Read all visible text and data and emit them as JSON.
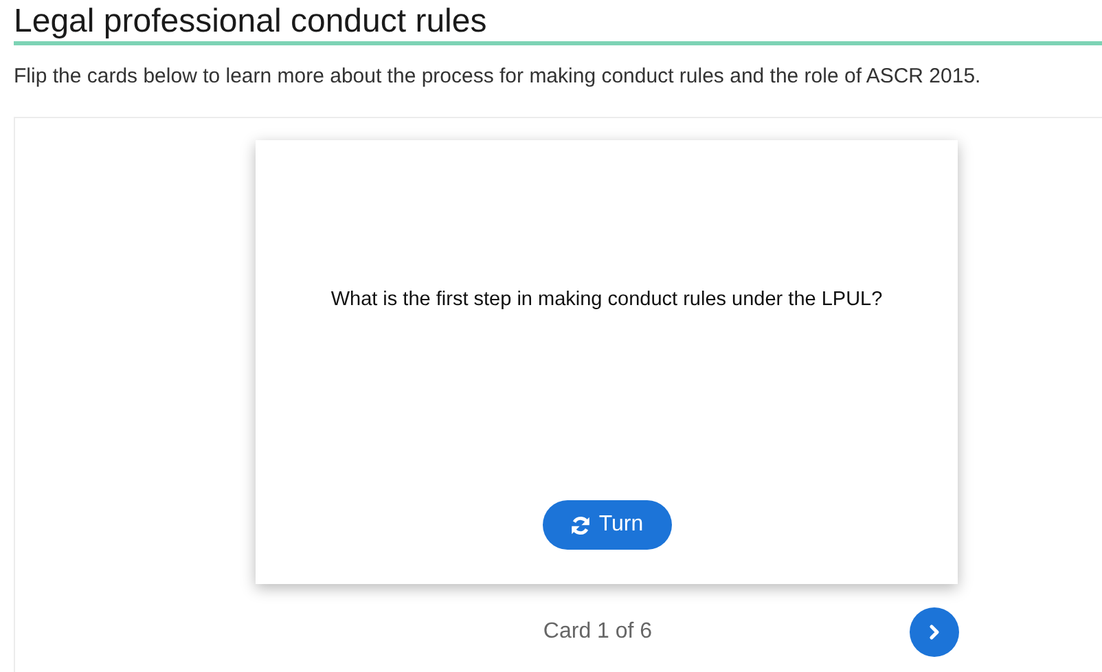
{
  "title": "Legal professional conduct rules",
  "intro": "Flip the cards below to learn more about the process for making conduct rules and the role of ASCR 2015.",
  "card": {
    "question": "What is the first step in making conduct rules under the LPUL?",
    "turn_label": "Turn"
  },
  "counter": "Card 1 of 6"
}
